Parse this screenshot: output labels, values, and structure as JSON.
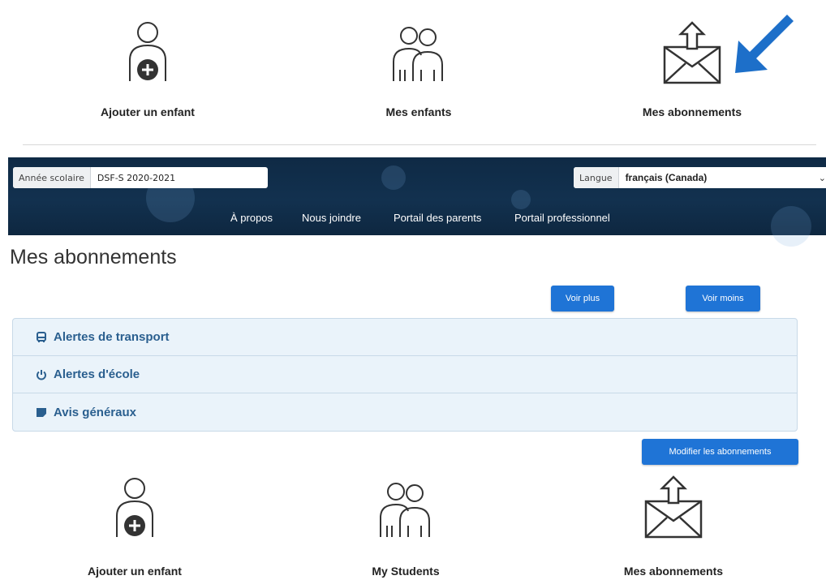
{
  "top_tiles": [
    {
      "label": "Ajouter un enfant",
      "icon": "add-child-icon"
    },
    {
      "label": "Mes enfants",
      "icon": "children-icon"
    },
    {
      "label": "Mes abonnements",
      "icon": "envelope-upload-icon"
    }
  ],
  "portal": {
    "school_year_label": "Année scolaire",
    "school_year_value": "DSF-S 2020-2021",
    "language_label": "Langue",
    "language_value": "français (Canada)",
    "nav": [
      "À propos",
      "Nous joindre",
      "Portail des parents",
      "Portail professionnel"
    ]
  },
  "page_title": "Mes abonnements",
  "buttons": {
    "see_more": "Voir plus",
    "see_less": "Voir moins",
    "modify": "Modifier les abonnements"
  },
  "accordion": [
    {
      "label": "Alertes de transport",
      "icon": "bus-icon"
    },
    {
      "label": "Alertes d'école",
      "icon": "power-icon"
    },
    {
      "label": "Avis généraux",
      "icon": "notes-icon"
    }
  ],
  "bottom_tiles": [
    {
      "label": "Ajouter un enfant",
      "icon": "add-child-icon"
    },
    {
      "label": "My Students",
      "icon": "children-icon"
    },
    {
      "label": "Mes abonnements",
      "icon": "envelope-upload-icon"
    }
  ],
  "colors": {
    "accent_blue": "#1f74d6",
    "arrow_blue": "#1d6fc9",
    "portal_bar": "#12314f",
    "accordion_bg": "#eaf3fa",
    "accordion_text": "#2a5f8f"
  }
}
